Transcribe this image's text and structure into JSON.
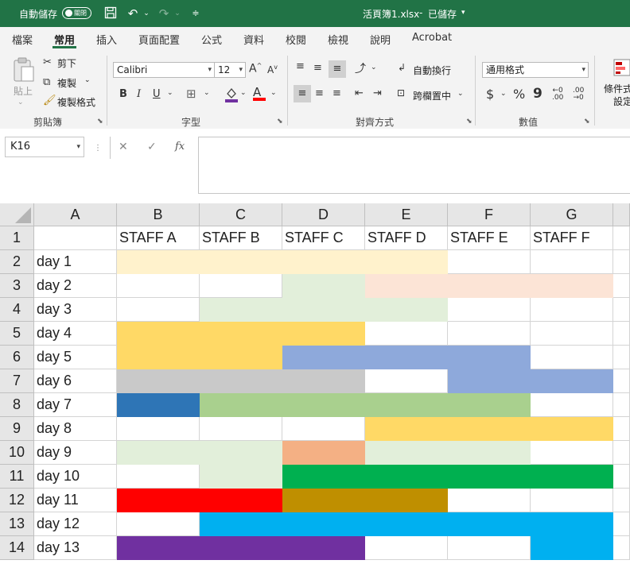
{
  "titlebar": {
    "autosave_label": "自動儲存",
    "autosave_state": "關閉",
    "filename": "活頁簿1.xlsx",
    "save_status": "已儲存",
    "bg_color": "#217346"
  },
  "tabs": [
    "檔案",
    "常用",
    "插入",
    "頁面配置",
    "公式",
    "資料",
    "校閱",
    "檢視",
    "說明",
    "Acrobat"
  ],
  "active_tab": "常用",
  "ribbon": {
    "clipboard": {
      "paste": "貼上",
      "cut": "剪下",
      "copy": "複製",
      "format_painter": "複製格式",
      "group": "剪貼簿"
    },
    "font": {
      "name": "Calibri",
      "size": "12",
      "bold": "B",
      "italic": "I",
      "underline": "U",
      "group": "字型"
    },
    "alignment": {
      "wrap": "自動換行",
      "merge": "跨欄置中",
      "group": "對齊方式"
    },
    "number": {
      "format": "通用格式",
      "currency": "$",
      "percent": "%",
      "comma": "9",
      "group": "數值"
    },
    "styles": {
      "conditional_1": "條件式",
      "conditional_2": "設定"
    }
  },
  "formula_bar": {
    "name_box": "K16",
    "cancel": "✕",
    "enter": "✓",
    "fx": "fx",
    "content": ""
  },
  "sheet": {
    "columns": [
      "A",
      "B",
      "C",
      "D",
      "E",
      "F",
      "G"
    ],
    "header_row": [
      "",
      "STAFF A",
      "STAFF B",
      "STAFF C",
      "STAFF D",
      "STAFF E",
      "STAFF F"
    ],
    "rows": [
      {
        "n": "1",
        "label": ""
      },
      {
        "n": "2",
        "label": "day 1"
      },
      {
        "n": "3",
        "label": "day 2"
      },
      {
        "n": "4",
        "label": "day 3"
      },
      {
        "n": "5",
        "label": "day 4"
      },
      {
        "n": "6",
        "label": "day 5"
      },
      {
        "n": "7",
        "label": "day 6"
      },
      {
        "n": "8",
        "label": "day 7"
      },
      {
        "n": "9",
        "label": "day 8"
      },
      {
        "n": "10",
        "label": "day 9"
      },
      {
        "n": "11",
        "label": "day 10"
      },
      {
        "n": "12",
        "label": "day 11"
      },
      {
        "n": "13",
        "label": "day 12"
      },
      {
        "n": "14",
        "label": "day 13"
      }
    ],
    "fills": [
      {
        "row": 2,
        "from": 1,
        "to": 4,
        "color": "#fff2cc"
      },
      {
        "row": 3,
        "from": 3,
        "to": 3,
        "color": "#e2efda"
      },
      {
        "row": 3,
        "from": 4,
        "to": 6,
        "color": "#fce4d6"
      },
      {
        "row": 4,
        "from": 2,
        "to": 4,
        "color": "#e2efda"
      },
      {
        "row": 5,
        "from": 1,
        "to": 3,
        "color": "#ffd966"
      },
      {
        "row": 6,
        "from": 1,
        "to": 2,
        "color": "#ffd966"
      },
      {
        "row": 6,
        "from": 3,
        "to": 5,
        "color": "#8ea9db"
      },
      {
        "row": 7,
        "from": 1,
        "to": 3,
        "color": "#c9c9c9"
      },
      {
        "row": 7,
        "from": 5,
        "to": 6,
        "color": "#8ea9db"
      },
      {
        "row": 8,
        "from": 1,
        "to": 1,
        "color": "#2e75b6"
      },
      {
        "row": 8,
        "from": 2,
        "to": 5,
        "color": "#a9d08e"
      },
      {
        "row": 9,
        "from": 4,
        "to": 6,
        "color": "#ffd966"
      },
      {
        "row": 10,
        "from": 1,
        "to": 2,
        "color": "#e2efda"
      },
      {
        "row": 10,
        "from": 3,
        "to": 3,
        "color": "#f4b084"
      },
      {
        "row": 10,
        "from": 4,
        "to": 5,
        "color": "#e2efda"
      },
      {
        "row": 11,
        "from": 2,
        "to": 2,
        "color": "#e2efda"
      },
      {
        "row": 11,
        "from": 3,
        "to": 6,
        "color": "#00b050"
      },
      {
        "row": 12,
        "from": 1,
        "to": 2,
        "color": "#ff0000"
      },
      {
        "row": 12,
        "from": 3,
        "to": 4,
        "color": "#bf8f00"
      },
      {
        "row": 13,
        "from": 2,
        "to": 6,
        "color": "#00b0f0"
      },
      {
        "row": 14,
        "from": 1,
        "to": 3,
        "color": "#7030a0"
      },
      {
        "row": 14,
        "from": 6,
        "to": 6,
        "color": "#00b0f0"
      }
    ]
  }
}
